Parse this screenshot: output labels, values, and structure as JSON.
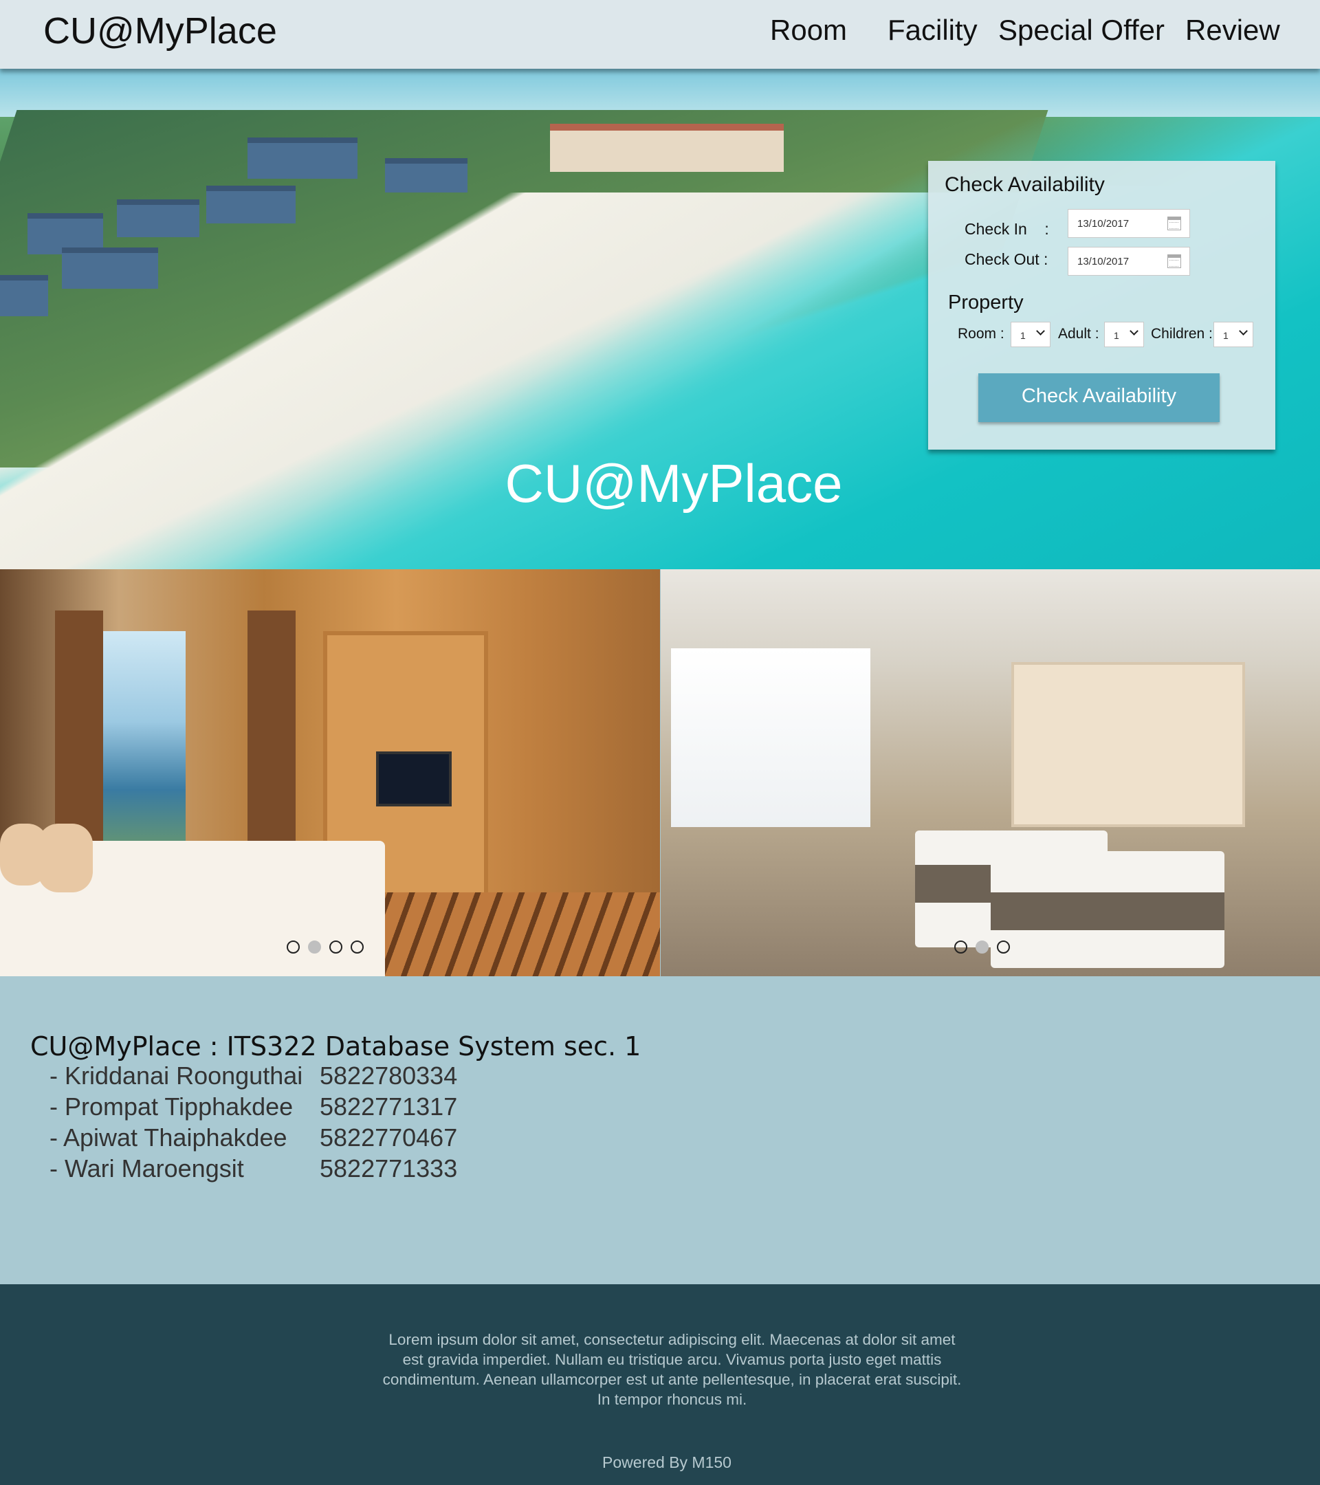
{
  "header": {
    "logo": "CU@MyPlace",
    "nav": [
      "Room",
      "Facility",
      "Special Offer",
      "Review"
    ]
  },
  "hero": {
    "title": "CU@MyPlace"
  },
  "availability": {
    "title": "Check Availability",
    "check_in_label": "Check In    :",
    "check_in_value": "13/10/2017",
    "check_out_label": "Check Out :",
    "check_out_value": "13/10/2017",
    "property_title": "Property",
    "room_label": "Room :",
    "room_value": "1",
    "adult_label": "Adult :",
    "adult_value": "1",
    "children_label": "Children :",
    "children_value": "1",
    "button_label": "Check Availability"
  },
  "carousel": {
    "left_dots": 4,
    "left_active": 2,
    "right_dots": 3,
    "right_active": 2
  },
  "info": {
    "title": "CU@MyPlace : ITS322 Database System sec. 1",
    "members": [
      {
        "name": "- Kriddanai Roonguthai",
        "id": "5822780334"
      },
      {
        "name": "- Prompat Tipphakdee",
        "id": "5822771317"
      },
      {
        "name": "- Apiwat Thaiphakdee",
        "id": "5822770467"
      },
      {
        "name": "- Wari Maroengsit",
        "id": "5822771333"
      }
    ]
  },
  "footer": {
    "text": "Lorem ipsum dolor sit amet, consectetur adipiscing elit. Maecenas at dolor sit amet est gravida imperdiet. Nullam eu tristique arcu. Vivamus porta justo eget mattis condimentum. Aenean ullamcorper est ut ante pellentesque, in placerat erat suscipit. In tempor rhoncus mi.",
    "powered": "Powered By M150"
  },
  "colors": {
    "nav_bg": "#dde7eb",
    "info_bg": "#a9c9d2",
    "footer_bg": "#234550",
    "button_bg": "#5ba9bf"
  }
}
